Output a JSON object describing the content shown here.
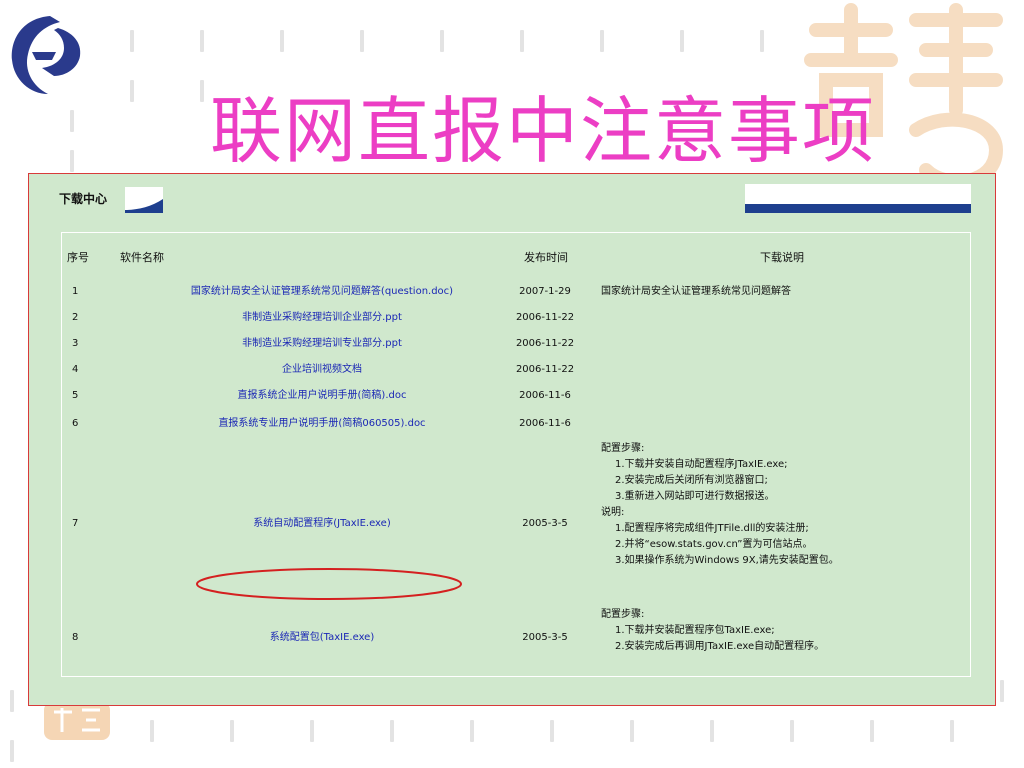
{
  "slide": {
    "title": "联网直报中注意事项"
  },
  "download_center": {
    "title": "下载中心",
    "columns": {
      "number": "序号",
      "name": "软件名称",
      "date": "发布时间",
      "description": "下载说明"
    },
    "rows": [
      {
        "number": "1",
        "name": "国家统计局安全认证管理系统常见问题解答(question.doc)",
        "date": "2007-1-29",
        "description": "国家统计局安全认证管理系统常见问题解答"
      },
      {
        "number": "2",
        "name": "非制造业采购经理培训企业部分.ppt",
        "date": "2006-11-22",
        "description": ""
      },
      {
        "number": "3",
        "name": "非制造业采购经理培训专业部分.ppt",
        "date": "2006-11-22",
        "description": ""
      },
      {
        "number": "4",
        "name": "企业培训视频文档",
        "date": "2006-11-22",
        "description": ""
      },
      {
        "number": "5",
        "name": "直报系统企业用户说明手册(简稿).doc",
        "date": "2006-11-6",
        "description": ""
      },
      {
        "number": "6",
        "name": "直报系统专业用户说明手册(简稿060505).doc",
        "date": "2006-11-6",
        "description": ""
      },
      {
        "number": "7",
        "name": "系统自动配置程序(JTaxIE.exe)",
        "date": "2005-3-5",
        "desc_lines": [
          "配置步骤:",
          "1.下载并安装自动配置程序JTaxIE.exe;",
          "2.安装完成后关闭所有浏览器窗口;",
          "3.重新进入网站即可进行数据报送。",
          "说明:",
          "1.配置程序将完成组件JTFile.dll的安装注册;",
          "2.并将“esow.stats.gov.cn”置为可信站点。",
          "3.如果操作系统为Windows 9X,请先安装配置包。"
        ]
      },
      {
        "number": "8",
        "name": "系统配置包(TaxIE.exe)",
        "date": "2005-3-5",
        "desc_lines": [
          "配置步骤:",
          "1.下载并安装配置程序包TaxIE.exe;",
          "2.安装完成后再调用JTaxIE.exe自动配置程序。"
        ]
      }
    ]
  },
  "colors": {
    "title": "#ec3ec4",
    "panel_bg": "#d0e8cd",
    "frame_border": "#d83a3a",
    "link": "#1b27b5",
    "highlight_ellipse": "#d42020"
  }
}
